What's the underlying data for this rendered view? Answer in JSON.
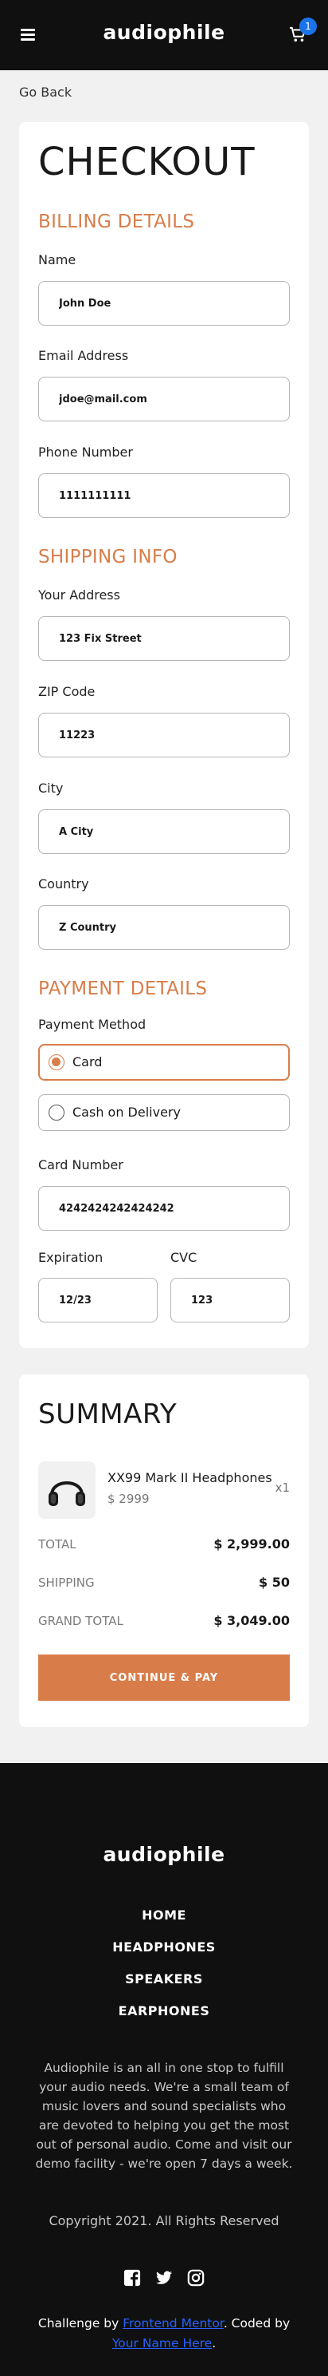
{
  "header": {
    "logo": "audiophile",
    "cart_count": "1"
  },
  "nav": {
    "go_back": "Go Back"
  },
  "checkout": {
    "title": "CHECKOUT",
    "billing": {
      "title": "BILLING DETAILS",
      "name_label": "Name",
      "name_value": "John Doe",
      "email_label": "Email Address",
      "email_value": "jdoe@mail.com",
      "phone_label": "Phone Number",
      "phone_value": "1111111111"
    },
    "shipping": {
      "title": "SHIPPING INFO",
      "address_label": "Your Address",
      "address_value": "123 Fix Street",
      "zip_label": "ZIP Code",
      "zip_value": "11223",
      "city_label": "City",
      "city_value": "A City",
      "country_label": "Country",
      "country_value": "Z Country"
    },
    "payment": {
      "title": "PAYMENT DETAILS",
      "method_label": "Payment Method",
      "options": [
        {
          "label": "Card",
          "selected": true
        },
        {
          "label": "Cash on Delivery",
          "selected": false
        }
      ],
      "card_label": "Card Number",
      "card_value": "4242424242424242",
      "expiration_label": "Expiration",
      "expiration_value": "12/23",
      "cvc_label": "CVC",
      "cvc_value": "123"
    }
  },
  "summary": {
    "title": "SUMMARY",
    "item": {
      "name": "XX99 Mark II Headphones",
      "price": "$ 2999",
      "qty": "x1"
    },
    "total_label": "TOTAL",
    "total_value": "$ 2,999.00",
    "shipping_label": "SHIPPING",
    "shipping_value": "$ 50",
    "grand_label": "GRAND TOTAL",
    "grand_value": "$ 3,049.00",
    "button": "CONTINUE & PAY"
  },
  "footer": {
    "logo": "audiophile",
    "nav": [
      "HOME",
      "HEADPHONES",
      "SPEAKERS",
      "EARPHONES"
    ],
    "description": "Audiophile is an all in one stop to fulfill your audio needs. We're a small team of music lovers and sound specialists who are devoted to helping you get the most out of personal audio. Come and visit our demo facility - we're open 7 days a week.",
    "copyright": "Copyright 2021. All Rights Reserved",
    "credit_prefix": "Challenge by ",
    "credit_link1": "Frontend Mentor",
    "credit_mid": ". Coded by ",
    "credit_link2": "Your Name Here",
    "credit_suffix": "."
  },
  "colors": {
    "accent": "#d87d4a",
    "dark": "#101010",
    "background": "#f1f1f1",
    "badge": "#1a73e8",
    "link": "#2962ff"
  },
  "icons": [
    "hamburger-icon",
    "cart-icon",
    "facebook-icon",
    "twitter-icon",
    "instagram-icon",
    "headphones-thumbnail"
  ]
}
